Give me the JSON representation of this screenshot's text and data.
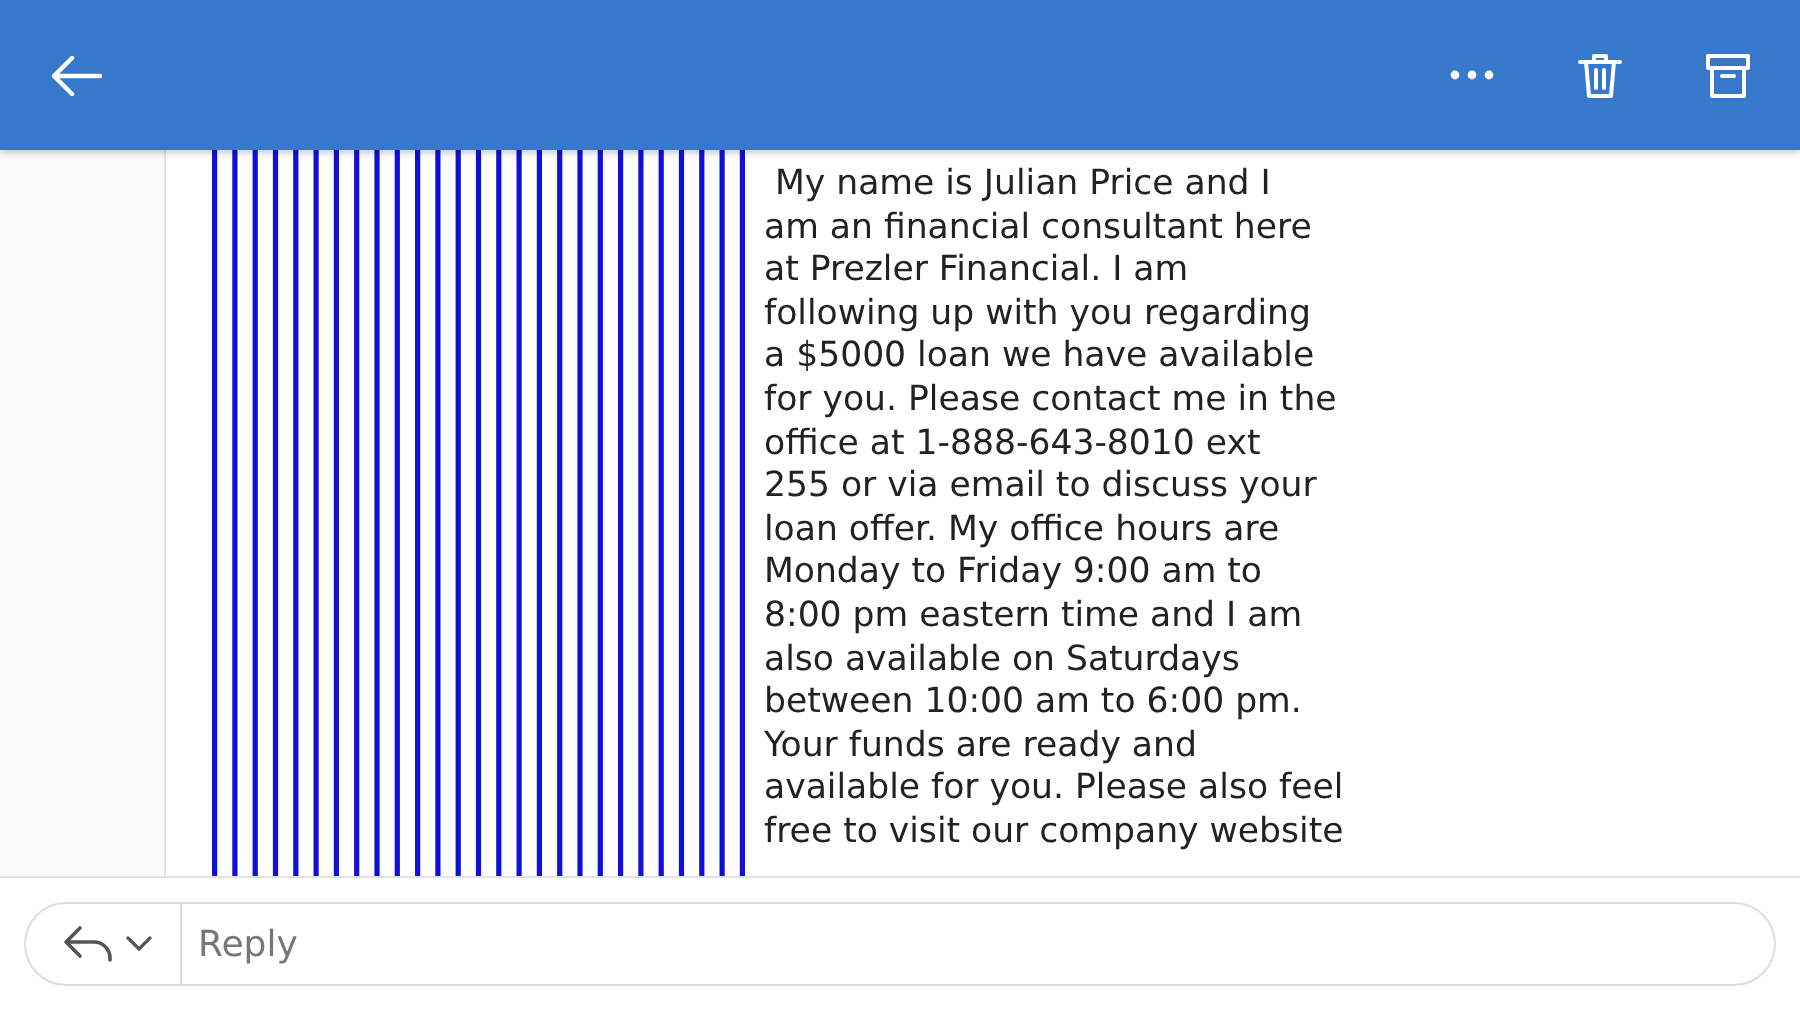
{
  "message": {
    "body_lines": [
      " My name is Julian Price and I",
      "am an financial consultant here",
      "at Prezler Financial. I am",
      "following up with you regarding",
      "a $5000 loan we have available",
      "for you. Please contact me in the",
      "office at 1-888-643-8010 ext",
      "255 or via email to discuss your",
      "loan offer. My office hours are",
      "Monday to Friday 9:00 am to",
      "8:00 pm eastern time and I am",
      "also available on Saturdays",
      "between 10:00 am to 6:00 pm.",
      "Your funds are ready and",
      "available for you. Please also feel",
      "free to visit our company website"
    ]
  },
  "reply": {
    "placeholder": "Reply"
  }
}
